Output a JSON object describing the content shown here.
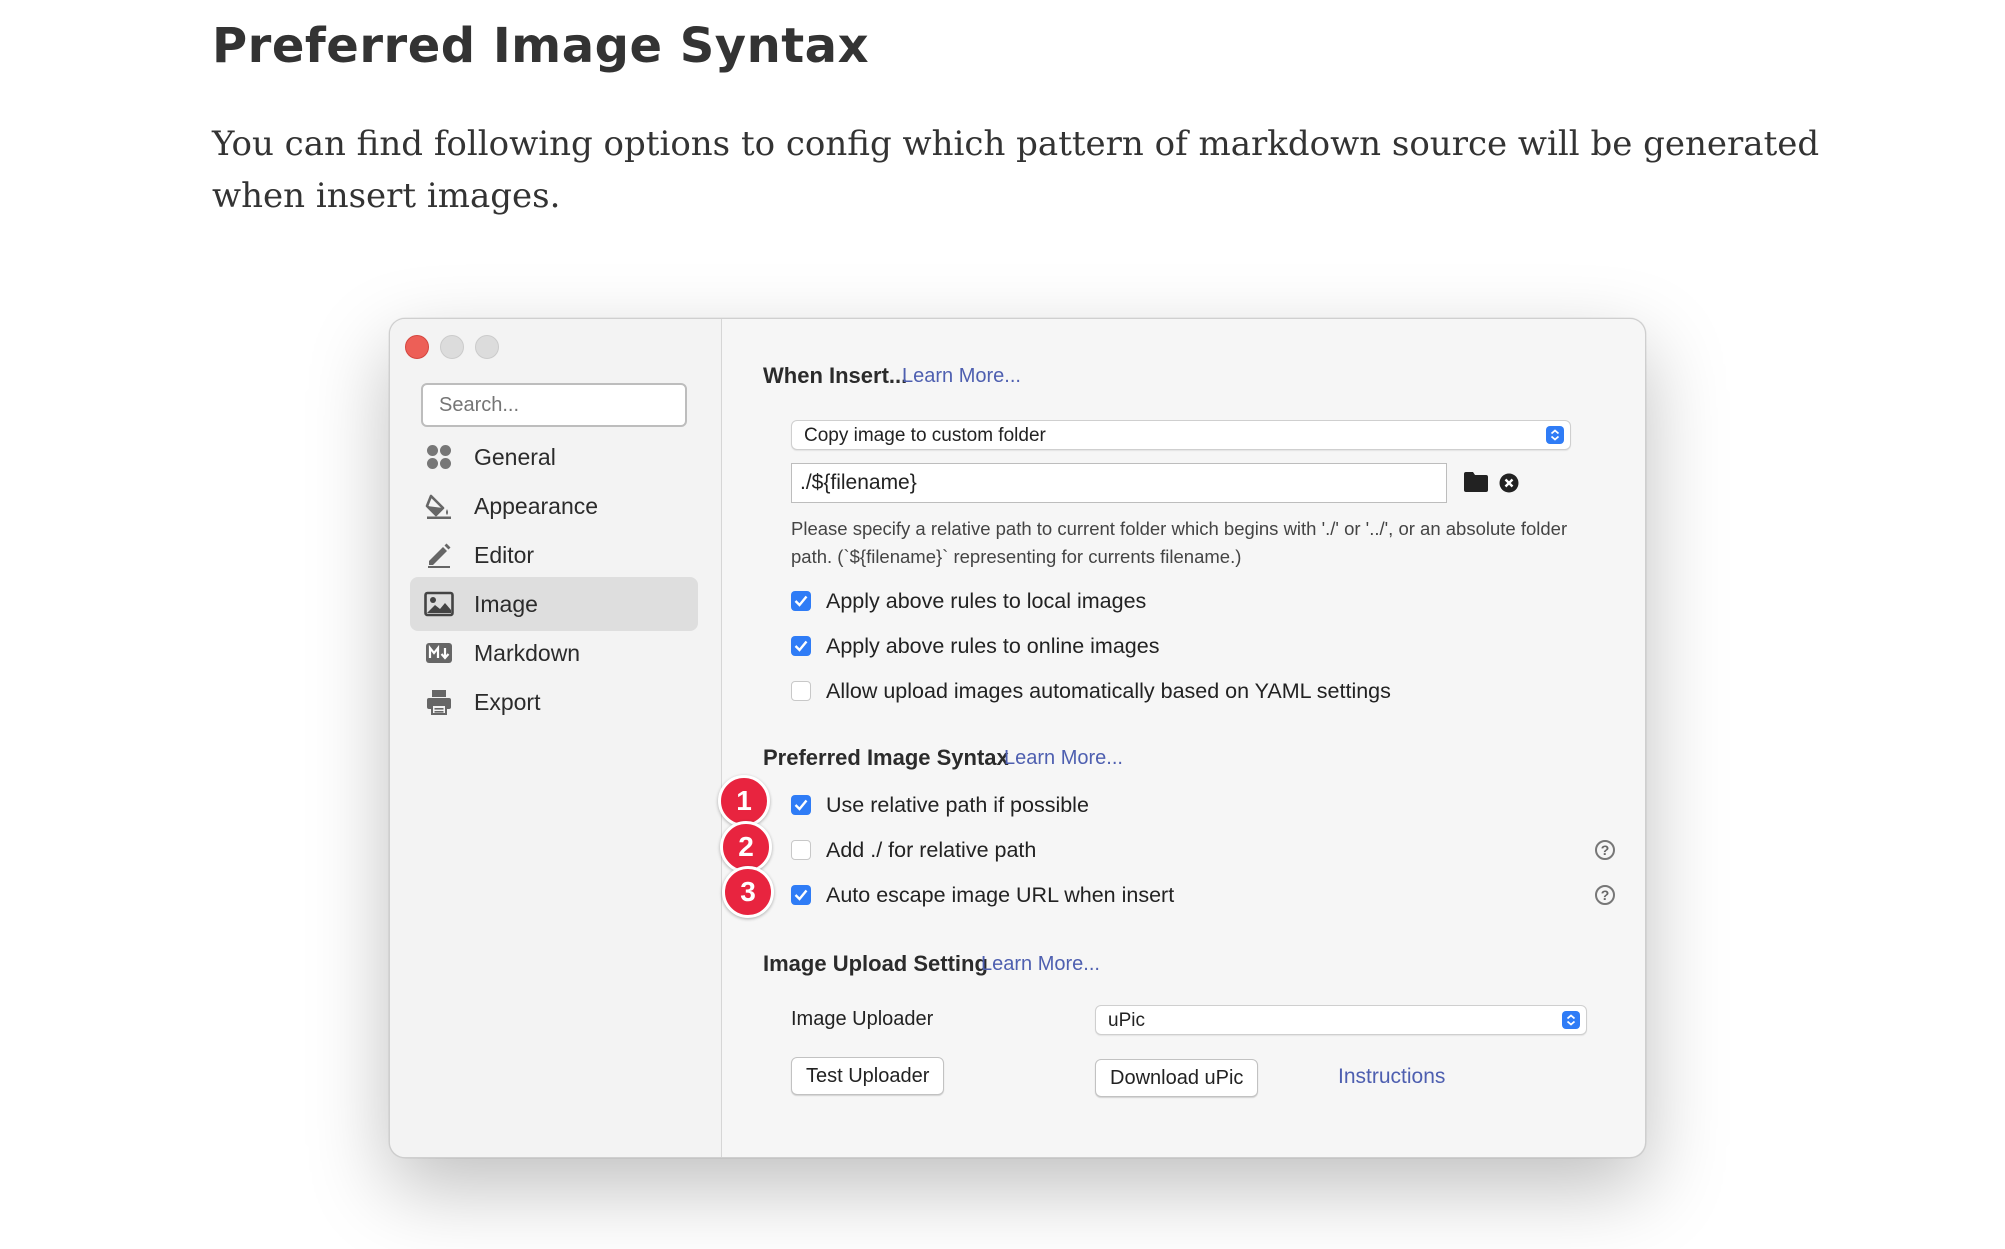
{
  "doc": {
    "title": "Preferred Image Syntax",
    "paragraph": "You can find following options to config which pattern of markdown source will be generated when insert images."
  },
  "sidebar": {
    "search_placeholder": "Search...",
    "items": [
      {
        "label": "General",
        "icon": "grid-icon"
      },
      {
        "label": "Appearance",
        "icon": "paint-bucket-icon"
      },
      {
        "label": "Editor",
        "icon": "pencil-icon"
      },
      {
        "label": "Image",
        "icon": "image-icon",
        "active": true
      },
      {
        "label": "Markdown",
        "icon": "markdown-icon"
      },
      {
        "label": "Export",
        "icon": "printer-icon"
      }
    ]
  },
  "when_insert": {
    "heading": "When Insert...",
    "learn_more": "Learn More...",
    "select_value": "Copy image to custom folder",
    "path_value": "./${filename}",
    "hint": "Please specify a relative path to current folder which begins with './' or '../', or an absolute folder path. (`${filename}` representing for currents filename.)",
    "options": [
      {
        "label": "Apply above rules to local images",
        "checked": true
      },
      {
        "label": "Apply above rules to online images",
        "checked": true
      },
      {
        "label": "Allow upload images automatically based on YAML settings",
        "checked": false
      }
    ]
  },
  "syntax": {
    "heading": "Preferred Image Syntax",
    "learn_more": "Learn More...",
    "options": [
      {
        "badge": "1",
        "label": "Use relative path if possible",
        "checked": true
      },
      {
        "badge": "2",
        "label": "Add ./ for relative path",
        "checked": false,
        "help": "?"
      },
      {
        "badge": "3",
        "label": "Auto escape image URL when insert",
        "checked": true,
        "help": "?"
      }
    ]
  },
  "upload": {
    "heading": "Image Upload Setting",
    "learn_more": "Learn More...",
    "uploader_label": "Image Uploader",
    "uploader_value": "uPic",
    "test_button": "Test Uploader",
    "download_button": "Download uPic",
    "instructions_link": "Instructions"
  },
  "colors": {
    "accent": "#2f7cf6",
    "link": "#4e5fb0",
    "badge": "#e8243f",
    "close": "#ed5f57"
  }
}
